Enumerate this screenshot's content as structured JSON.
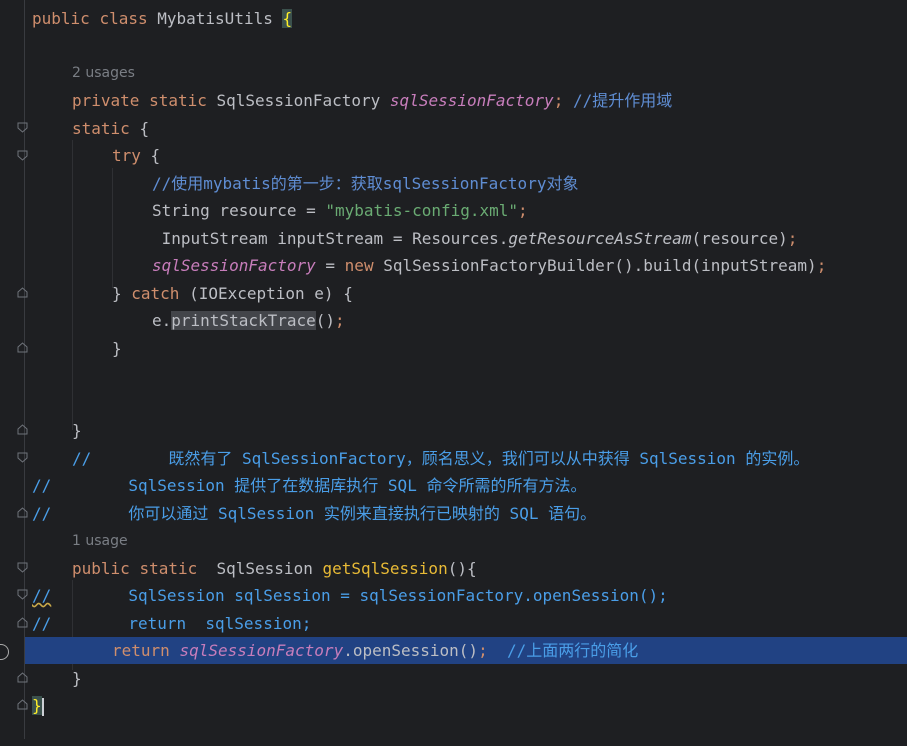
{
  "editor": {
    "lines": {
      "l1": {
        "kw1": "public",
        "kw2": "class",
        "name": "MybatisUtils",
        "brace": "{"
      },
      "hint1": "2 usages",
      "l2": {
        "kw1": "private",
        "kw2": "static",
        "type": "SqlSessionFactory",
        "field": "sqlSessionFactory",
        "semi": ";",
        "comment": "//提升作用域"
      },
      "l3": {
        "kw": "static",
        "brace": "{"
      },
      "l4": {
        "kw": "try",
        "brace": "{"
      },
      "l5": {
        "comment": "//使用mybatis的第一步：获取sqlSessionFactory对象"
      },
      "l6": {
        "decl": "String resource = ",
        "str": "\"mybatis-config.xml\"",
        "semi": ";"
      },
      "l7": {
        "decl": " InputStream inputStream = Resources.",
        "call": "getResourceAsStream",
        "args": "(resource)",
        "semi": ";"
      },
      "l8": {
        "field": "sqlSessionFactory",
        "eq": " = ",
        "kw": "new",
        "rest": " SqlSessionFactoryBuilder().build(inputStream)",
        "semi": ";"
      },
      "l9": {
        "close": "} ",
        "kw": "catch",
        "rest": " (IOException e) {"
      },
      "l10": {
        "obj": "e.",
        "call": "printStackTrace",
        "args": "()",
        "semi": ";"
      },
      "l11": {
        "close": "}"
      },
      "l12": {
        "close": "}"
      },
      "l13": {
        "text": "//        既然有了 SqlSessionFactory，顾名思义，我们可以从中获得 SqlSession 的实例。"
      },
      "l14": {
        "text": "//        SqlSession 提供了在数据库执行 SQL 命令所需的所有方法。"
      },
      "l15": {
        "text": "//        你可以通过 SqlSession 实例来直接执行已映射的 SQL 语句。"
      },
      "hint2": "1 usage",
      "l16": {
        "kw1": "public",
        "kw2": "static",
        "type": "  SqlSession ",
        "method": "getSqlSession",
        "rest": "(){"
      },
      "l17": {
        "slashes": "//",
        "text": "        SqlSession sqlSession = sqlSessionFactory.openSession();"
      },
      "l18": {
        "text": "//        return  sqlSession;"
      },
      "l19": {
        "kw": "return",
        "field": "sqlSessionFactory",
        "rest": ".openSession()",
        "semi": ";",
        "comment": "  //上面两行的简化"
      },
      "l20": {
        "close": "}"
      },
      "l21": {
        "close": "}"
      }
    }
  },
  "colors": {
    "background": "#1e1f22",
    "keyword": "#cf8e6d",
    "field": "#c77dbb",
    "comment": "#5f8dd3",
    "string": "#6aab73",
    "method": "#56a8f5",
    "selection": "#214283"
  }
}
